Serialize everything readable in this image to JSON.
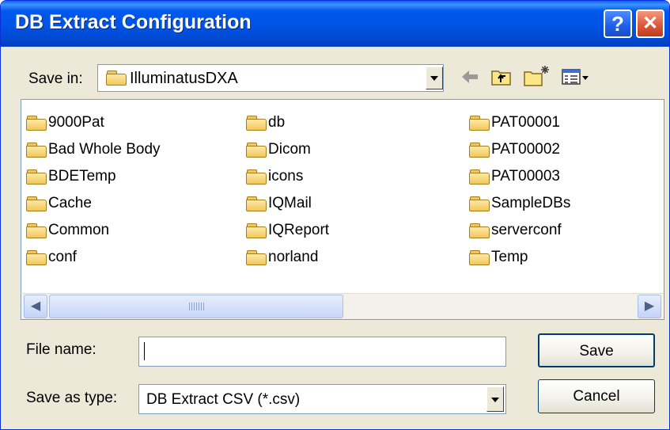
{
  "window": {
    "title": "DB Extract Configuration",
    "help_glyph": "?",
    "close_glyph": "✕"
  },
  "save_in": {
    "label": "Save in:",
    "value": "IlluminatusDXA"
  },
  "files": [
    "9000Pat",
    "Bad Whole Body",
    "BDETemp",
    "Cache",
    "Common",
    "conf",
    "db",
    "Dicom",
    "icons",
    "IQMail",
    "IQReport",
    "norland",
    "PAT00001",
    "PAT00002",
    "PAT00003",
    "SampleDBs",
    "serverconf",
    "Temp"
  ],
  "file_name": {
    "label": "File name:",
    "value": ""
  },
  "save_as_type": {
    "label": "Save as type:",
    "value": "DB Extract CSV (*.csv)"
  },
  "buttons": {
    "save": "Save",
    "cancel": "Cancel"
  },
  "icons": [
    "folder-icon",
    "back-arrow-icon",
    "up-folder-icon",
    "new-folder-icon",
    "view-menu-icon",
    "dropdown-arrow-icon",
    "scroll-left-icon",
    "scroll-right-icon"
  ],
  "colors": {
    "titlebar": "#0054e3",
    "dialog_bg": "#ece9d8",
    "border": "#7f9db9"
  }
}
